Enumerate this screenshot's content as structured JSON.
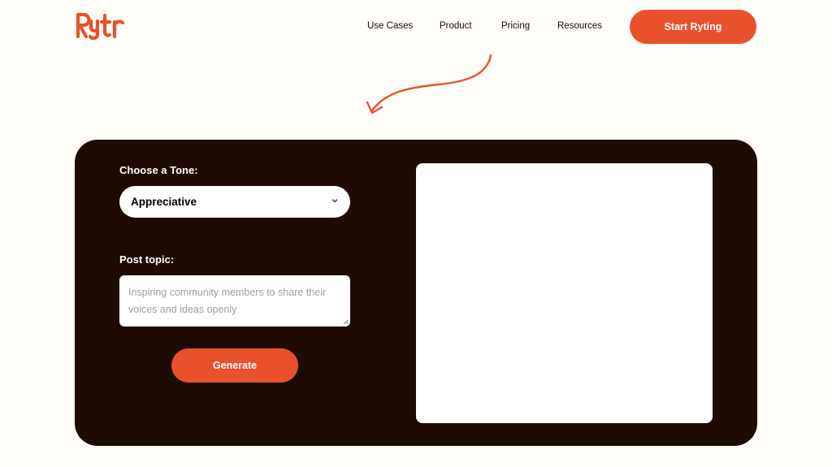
{
  "brand": {
    "logo_text": "Rytr",
    "accent_color": "#E8512C",
    "dark_color": "#1E0B04",
    "page_bg": "#FEFDF8"
  },
  "nav": {
    "links": [
      {
        "label": "Use Cases"
      },
      {
        "label": "Product"
      },
      {
        "label": "Pricing"
      },
      {
        "label": "Resources"
      }
    ],
    "cta_label": "Start Ryting"
  },
  "tool": {
    "tone_label": "Choose a Tone:",
    "tone_value": "Appreciative",
    "topic_label": "Post topic:",
    "topic_placeholder": "Inspiring community members to share their voices and ideas openly",
    "generate_label": "Generate",
    "output_text": ""
  },
  "icons": {
    "chevron": "chevron-down-icon",
    "arrow": "curved-arrow-icon",
    "resize": "resize-grip-icon"
  }
}
